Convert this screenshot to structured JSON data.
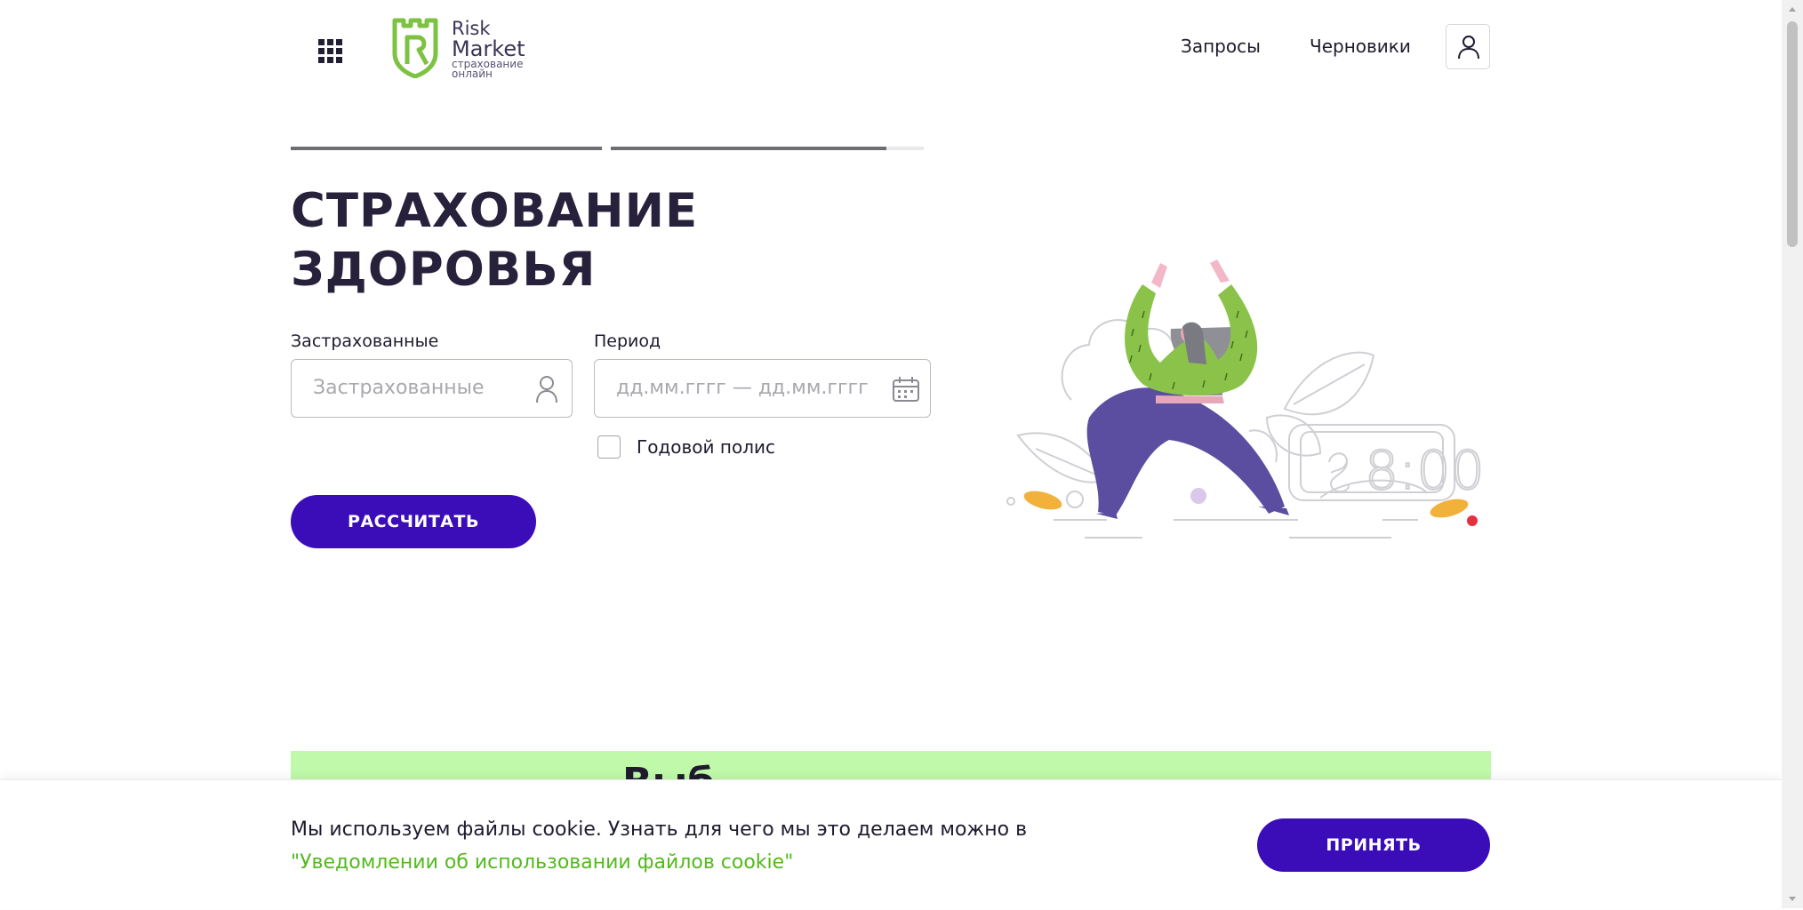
{
  "header": {
    "apps_icon": "grid-icon",
    "logo": {
      "line1": "Risk",
      "line2": "Market",
      "line3": "страхование",
      "line4": "онлайн",
      "brand_color": "#7dc242"
    },
    "nav": [
      {
        "label": "Запросы"
      },
      {
        "label": "Черновики"
      }
    ],
    "profile_icon": "user-icon"
  },
  "progress": {
    "step1": 1.0,
    "step2": 0.88
  },
  "hero": {
    "title_line1": "СТРАХОВАНИЕ",
    "title_line2": "ЗДОРОВЬЯ"
  },
  "form": {
    "insured": {
      "label": "Застрахованные",
      "placeholder": "Застрахованные",
      "icon": "user-icon"
    },
    "period": {
      "label": "Период",
      "placeholder": "дд.мм.гггг — дд.мм.гггг",
      "icon": "calendar-icon"
    },
    "annual_policy": {
      "label": "Годовой полис",
      "checked": false
    },
    "calculate_label": "РАССЧИТАТЬ"
  },
  "illustration": {
    "clock_text": "8:00"
  },
  "section": {
    "heading": "Выб",
    "background": "#c0f9a9"
  },
  "cookie": {
    "text": "Мы используем файлы cookie. Узнать для чего мы это делаем можно в",
    "link": "\"Уведомлении об использовании файлов cookie\"",
    "accept_label": "ПРИНЯТЬ"
  },
  "colors": {
    "primary": "#3b0db8",
    "accent_green": "#52b91e",
    "dark_text": "#28213b"
  }
}
